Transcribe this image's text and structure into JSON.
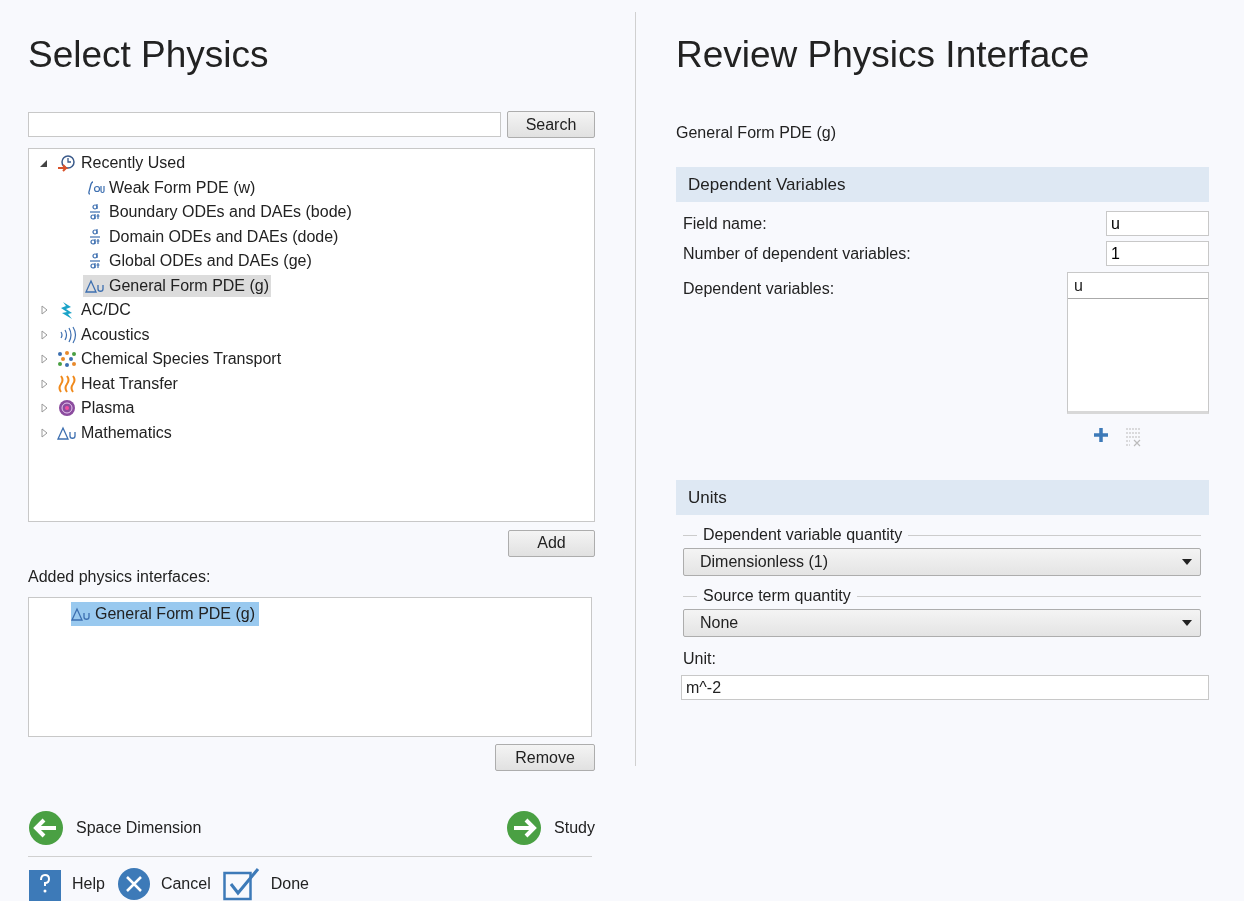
{
  "left": {
    "title": "Select Physics",
    "search": {
      "button": "Search"
    },
    "tree": [
      {
        "label": "Recently Used",
        "kind": "clock",
        "expanded": true,
        "selected": false,
        "children": [
          {
            "label": "Weak Form PDE (w)",
            "kind": "integral",
            "selected": false
          },
          {
            "label": "Boundary ODEs and DAEs (bode)",
            "kind": "ddt",
            "selected": false
          },
          {
            "label": "Domain ODEs and DAEs (dode)",
            "kind": "ddt",
            "selected": false
          },
          {
            "label": "Global ODEs and DAEs (ge)",
            "kind": "ddt",
            "selected": false
          },
          {
            "label": "General Form PDE (g)",
            "kind": "delta",
            "selected": true
          }
        ]
      },
      {
        "label": "AC/DC",
        "kind": "bolt",
        "expanded": false,
        "selected": false
      },
      {
        "label": "Acoustics",
        "kind": "waves",
        "expanded": false,
        "selected": false
      },
      {
        "label": "Chemical Species Transport",
        "kind": "dots",
        "expanded": false,
        "selected": false
      },
      {
        "label": "Heat Transfer",
        "kind": "heat",
        "expanded": false,
        "selected": false
      },
      {
        "label": "Plasma",
        "kind": "plasma",
        "expanded": false,
        "selected": false
      },
      {
        "label": "Mathematics",
        "kind": "delta",
        "expanded": false,
        "selected": false
      }
    ],
    "add_button": "Add",
    "added_label": "Added physics interfaces:",
    "added": [
      {
        "label": "General Form PDE (g)",
        "kind": "delta",
        "selected": true
      }
    ],
    "remove_button": "Remove",
    "nav": {
      "back": "Space Dimension",
      "next": "Study"
    },
    "actions": [
      {
        "kind": "help",
        "label": "Help"
      },
      {
        "kind": "cancel",
        "label": "Cancel"
      },
      {
        "kind": "done",
        "label": "Done"
      }
    ]
  },
  "right": {
    "title": "Review Physics Interface",
    "subtitle": "General Form PDE (g)",
    "dependent_variables": {
      "header": "Dependent Variables",
      "field_name_label": "Field name:",
      "field_name": "u",
      "count_label": "Number of dependent variables:",
      "count": "1",
      "list_label": "Dependent variables:",
      "list": [
        "u"
      ]
    },
    "units": {
      "header": "Units",
      "groups": [
        {
          "legend": "Dependent variable quantity",
          "value": "Dimensionless (1)"
        },
        {
          "legend": "Source term quantity",
          "value": "None"
        }
      ],
      "unit_label": "Unit:",
      "unit": "m^-2"
    }
  }
}
